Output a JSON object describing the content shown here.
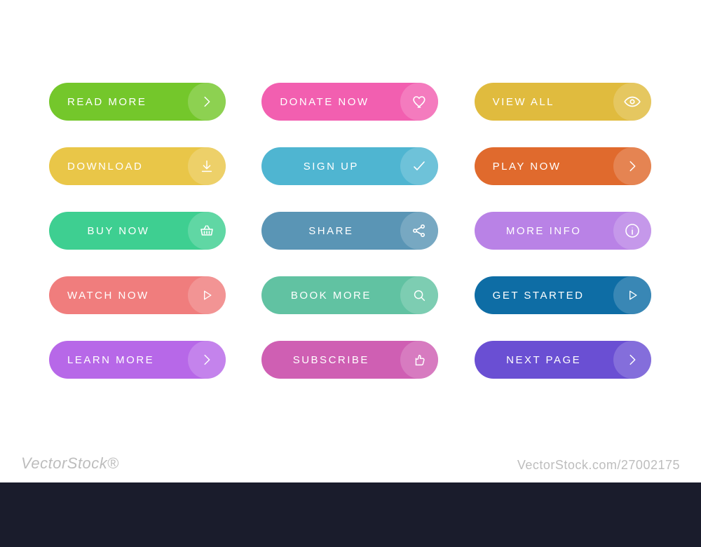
{
  "buttons": [
    {
      "id": "read-more",
      "label": "READ MORE",
      "icon": "chevron-right",
      "color": "#74c72b",
      "align": "left"
    },
    {
      "id": "donate-now",
      "label": "DONATE NOW",
      "icon": "heart",
      "color": "#f25fb0",
      "align": "left"
    },
    {
      "id": "view-all",
      "label": "VIEW ALL",
      "icon": "eye",
      "color": "#e0bb3e",
      "align": "left"
    },
    {
      "id": "download",
      "label": "DOWNLOAD",
      "icon": "download",
      "color": "#e9c648",
      "align": "left"
    },
    {
      "id": "sign-up",
      "label": "SIGN UP",
      "icon": "check",
      "color": "#4fb5d1",
      "align": "center"
    },
    {
      "id": "play-now",
      "label": "PLAY NOW",
      "icon": "chevron-right",
      "color": "#e06a2d",
      "align": "left"
    },
    {
      "id": "buy-now",
      "label": "BUY NOW",
      "icon": "basket",
      "color": "#3ecf91",
      "align": "center"
    },
    {
      "id": "share",
      "label": "SHARE",
      "icon": "share",
      "color": "#5a95b5",
      "align": "center"
    },
    {
      "id": "more-info",
      "label": "MORE INFO",
      "icon": "info",
      "color": "#b982e6",
      "align": "center"
    },
    {
      "id": "watch-now",
      "label": "WATCH NOW",
      "icon": "play",
      "color": "#f07d7d",
      "align": "left"
    },
    {
      "id": "book-more",
      "label": "BOOK MORE",
      "icon": "search",
      "color": "#61c2a2",
      "align": "center"
    },
    {
      "id": "get-started",
      "label": "GET STARTED",
      "icon": "play",
      "color": "#0e6da5",
      "align": "left"
    },
    {
      "id": "learn-more",
      "label": "LEARN MORE",
      "icon": "chevron-right",
      "color": "#b768e8",
      "align": "left"
    },
    {
      "id": "subscribe",
      "label": "SUBSCRIBE",
      "icon": "thumbs-up",
      "color": "#cf5fb3",
      "align": "center"
    },
    {
      "id": "next-page",
      "label": "NEXT PAGE",
      "icon": "chevron-right",
      "color": "#6a4fd3",
      "align": "center"
    }
  ],
  "watermark": {
    "brand": "VectorStock",
    "suffix": "®",
    "attribution": "VectorStock.com/27002175"
  }
}
